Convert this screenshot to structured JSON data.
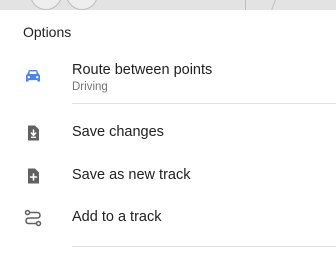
{
  "menu": {
    "title": "Options",
    "items": [
      {
        "label": "Route between points",
        "sublabel": "Driving",
        "icon": "car-icon",
        "color": "#4a86e8"
      },
      {
        "label": "Save changes",
        "icon": "save-changes-icon",
        "color": "#616161"
      },
      {
        "label": "Save as new track",
        "icon": "save-as-new-track-icon",
        "color": "#616161"
      },
      {
        "label": "Add to a track",
        "icon": "add-to-track-icon",
        "color": "#616161"
      }
    ]
  }
}
